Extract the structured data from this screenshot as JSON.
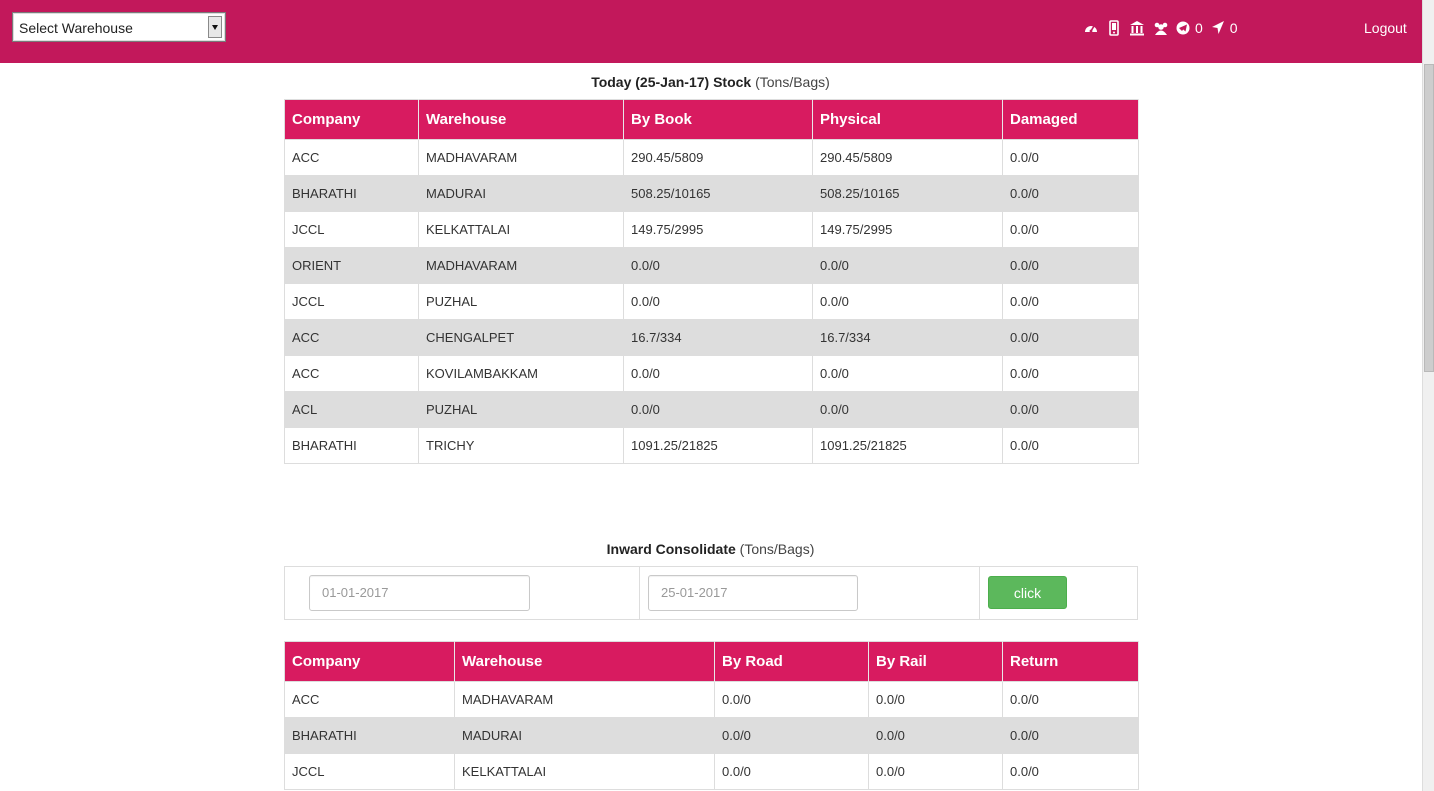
{
  "header": {
    "warehouse_select": "Select Warehouse",
    "icons": [
      "dashboard-icon",
      "mobile-icon",
      "bank-icon",
      "users-icon",
      "telegram-icon",
      "location-arrow-icon"
    ],
    "counts": [
      "0",
      "0"
    ],
    "logout": "Logout"
  },
  "stock": {
    "title_bold": "Today (25-Jan-17) Stock",
    "title_unit": "(Tons/Bags)",
    "columns": [
      "Company",
      "Warehouse",
      "By Book",
      "Physical",
      "Damaged"
    ],
    "rows": [
      [
        "ACC",
        "MADHAVARAM",
        "290.45/5809",
        "290.45/5809",
        "0.0/0"
      ],
      [
        "BHARATHI",
        "MADURAI",
        "508.25/10165",
        "508.25/10165",
        "0.0/0"
      ],
      [
        "JCCL",
        "KELKATTALAI",
        "149.75/2995",
        "149.75/2995",
        "0.0/0"
      ],
      [
        "ORIENT",
        "MADHAVARAM",
        "0.0/0",
        "0.0/0",
        "0.0/0"
      ],
      [
        "JCCL",
        "PUZHAL",
        "0.0/0",
        "0.0/0",
        "0.0/0"
      ],
      [
        "ACC",
        "CHENGALPET",
        "16.7/334",
        "16.7/334",
        "0.0/0"
      ],
      [
        "ACC",
        "KOVILAMBAKKAM",
        "0.0/0",
        "0.0/0",
        "0.0/0"
      ],
      [
        "ACL",
        "PUZHAL",
        "0.0/0",
        "0.0/0",
        "0.0/0"
      ],
      [
        "BHARATHI",
        "TRICHY",
        "1091.25/21825",
        "1091.25/21825",
        "0.0/0"
      ]
    ]
  },
  "inward": {
    "title_bold": "Inward Consolidate",
    "title_unit": "(Tons/Bags)",
    "from_date": "01-01-2017",
    "to_date": "25-01-2017",
    "button": "click",
    "columns": [
      "Company",
      "Warehouse",
      "By Road",
      "By Rail",
      "Return"
    ],
    "rows": [
      [
        "ACC",
        "MADHAVARAM",
        "0.0/0",
        "0.0/0",
        "0.0/0"
      ],
      [
        "BHARATHI",
        "MADURAI",
        "0.0/0",
        "0.0/0",
        "0.0/0"
      ],
      [
        "JCCL",
        "KELKATTALAI",
        "0.0/0",
        "0.0/0",
        "0.0/0"
      ]
    ]
  }
}
